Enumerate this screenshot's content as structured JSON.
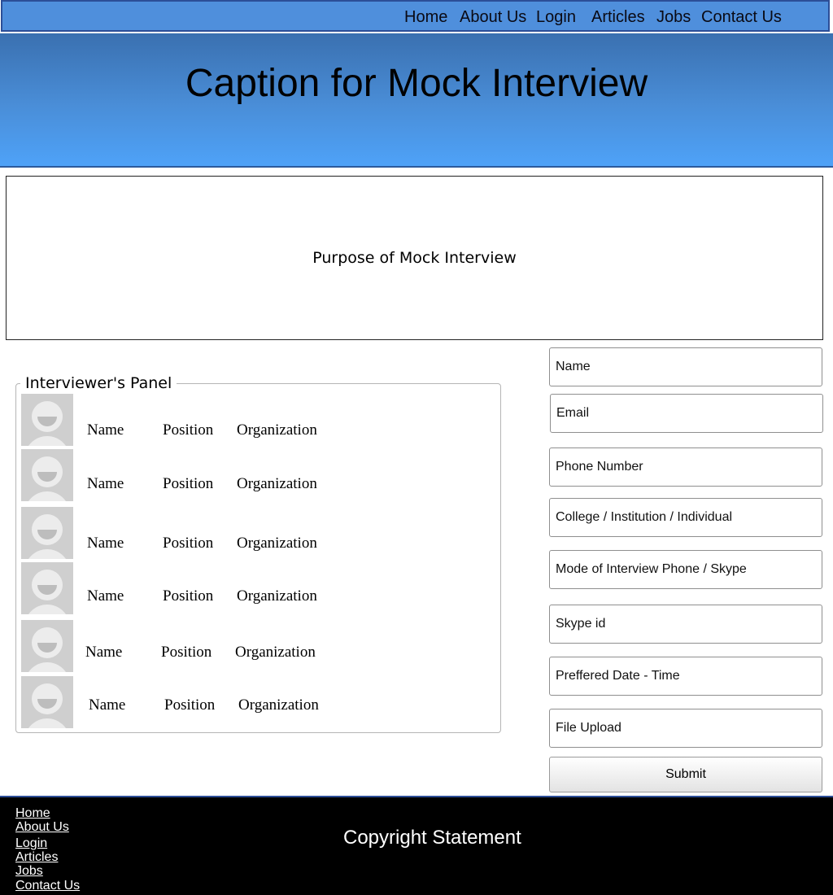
{
  "nav": {
    "items": [
      "Home",
      "About Us",
      "Login",
      "Articles",
      "Jobs",
      "Contact Us"
    ]
  },
  "header": {
    "title": "Caption for Mock Interview"
  },
  "purpose": {
    "text": "Purpose of Mock Interview"
  },
  "panel": {
    "title": "Interviewer's Panel",
    "rows": [
      {
        "name": "Name",
        "position": "Position",
        "organization": "Organization",
        "avatar": "user-avatar-icon"
      },
      {
        "name": "Name",
        "position": "Position",
        "organization": "Organization",
        "avatar": "user-avatar-icon"
      },
      {
        "name": "Name",
        "position": "Position",
        "organization": "Organization",
        "avatar": "user-avatar-icon"
      },
      {
        "name": "Name",
        "position": "Position",
        "organization": "Organization",
        "avatar": "user-avatar-icon"
      },
      {
        "name": "Name",
        "position": "Position",
        "organization": "Organization",
        "avatar": "user-avatar-icon"
      },
      {
        "name": "Name",
        "position": "Position",
        "organization": "Organization",
        "avatar": "user-avatar-icon"
      }
    ]
  },
  "form": {
    "fields": [
      {
        "placeholder": "Name"
      },
      {
        "placeholder": "Email"
      },
      {
        "placeholder": "Phone Number"
      },
      {
        "placeholder": "College / Institution / Individual"
      },
      {
        "placeholder": "Mode of Interview Phone / Skype"
      },
      {
        "placeholder": "Skype id"
      },
      {
        "placeholder": "Preffered Date - Time"
      },
      {
        "placeholder": "File Upload"
      }
    ],
    "submit_label": "Submit"
  },
  "footer": {
    "links": [
      "Home",
      "About Us",
      "Login",
      "Articles",
      "Jobs",
      "Contact Us"
    ],
    "copyright": "Copyright Statement"
  },
  "colors": {
    "nav_bg": "#4f8fdc",
    "header_gradient_top": "#3a70b0",
    "header_gradient_bottom": "#4ea2f8",
    "footer_bg": "#000000",
    "accent_border": "#2c4e97"
  }
}
